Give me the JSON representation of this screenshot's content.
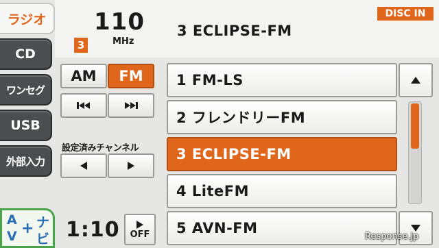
{
  "sidebar": {
    "tabs": [
      {
        "label": "ラジオ",
        "active": true
      },
      {
        "label": "CD",
        "active": false
      },
      {
        "label": "ワンセグ",
        "active": false
      },
      {
        "label": "USB",
        "active": false
      },
      {
        "label": "外部入力",
        "active": false
      }
    ],
    "navi": {
      "a": "A",
      "v": "V",
      "plus": "+",
      "na": "ナ",
      "bi": "ビ"
    }
  },
  "header": {
    "frequency": "110",
    "unit": "MHz",
    "preset_number": "3",
    "station_name": "3 ECLIPSE-FM",
    "disc_status": "DISC IN"
  },
  "controls": {
    "am_label": "AM",
    "fm_label": "FM",
    "selected_band": "FM",
    "preset_label": "設定済みチャンネル",
    "power_label": "OFF"
  },
  "clock": "1:10",
  "stations": [
    {
      "label": "1 FM-LS",
      "selected": false
    },
    {
      "label": "2 フレンドリーFM",
      "selected": false
    },
    {
      "label": "3 ECLIPSE-FM",
      "selected": true
    },
    {
      "label": "4 LiteFM",
      "selected": false
    },
    {
      "label": "5 AVN-FM",
      "selected": false
    }
  ],
  "scroll": {
    "position_fraction": 0.0
  },
  "watermark": "Response.jp",
  "colors": {
    "accent": "#e0661c",
    "tab_bg": "#4b4d50",
    "navi_border": "#4aa34a",
    "navi_text": "#2a6fb5"
  }
}
